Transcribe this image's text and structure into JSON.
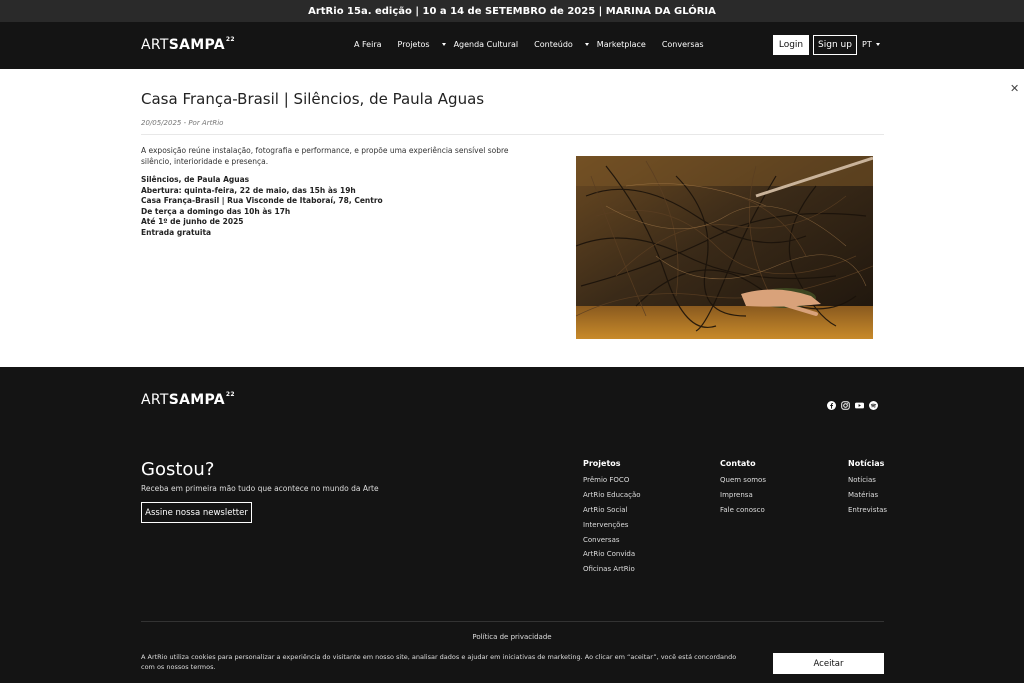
{
  "topbar": {
    "announcement": "ArtRio 15a. edição | 10 a 14 de SETEMBRO de 2025 | MARINA DA GLÓRIA"
  },
  "brand": {
    "logo_thin": "ART",
    "logo_bold": "SAMPA",
    "logo_sup": "22"
  },
  "nav": {
    "items": [
      {
        "label": "A Feira",
        "dropdown": false
      },
      {
        "label": "Projetos",
        "dropdown": true
      },
      {
        "label": "Agenda Cultural",
        "dropdown": false
      },
      {
        "label": "Conteúdo",
        "dropdown": true
      },
      {
        "label": "Marketplace",
        "dropdown": false
      },
      {
        "label": "Conversas",
        "dropdown": false
      }
    ],
    "login_label": "Login",
    "signup_label": "Sign up",
    "language": "PT"
  },
  "article": {
    "close_icon": "close-icon",
    "title": "Casa França-Brasil | Silêncios, de Paula Aguas",
    "meta": "20/05/2025 - Por ArtRio",
    "intro": "A exposição reúne instalação, fotografia e performance, e propõe uma experiência sensível sobre silêncio, interioridade e presença.",
    "details": [
      "Silêncios, de Paula Aguas",
      "Abertura: quinta-feira, 22 de maio, das 15h às 19h",
      "Casa França-Brasil | Rua Visconde de Itaboraí, 78, Centro",
      "De terça a domingo das 10h às 17h",
      "Até 1º de junho de 2025",
      "Entrada gratuita"
    ]
  },
  "footer": {
    "social_icons": [
      "facebook-icon",
      "instagram-icon",
      "youtube-icon",
      "spotify-icon"
    ],
    "gostou_title": "Gostou?",
    "gostou_sub": "Receba em primeira mão tudo que acontece no mundo da Arte",
    "newsletter_label": "Assine nossa newsletter",
    "columns": [
      {
        "heading": "Projetos",
        "items": [
          "Prêmio FOCO",
          "ArtRio Educação",
          "ArtRio Social",
          "Intervenções",
          "Conversas",
          "ArtRio Convida",
          "Oficinas ArtRio"
        ]
      },
      {
        "heading": "Contato",
        "items": [
          "Quem somos",
          "Imprensa",
          "Fale conosco"
        ]
      },
      {
        "heading": "Notícias",
        "items": [
          "Notícias",
          "Matérias",
          "Entrevistas"
        ]
      }
    ],
    "privacy_link": "Política de privacidade",
    "cookie_text": "A ArtRio utiliza cookies para personalizar a experiência do visitante em nosso site, analisar dados e ajudar em iniciativas de marketing. Ao clicar em “aceitar”, você está concordando com os nossos termos.",
    "accept_label": "Aceitar"
  }
}
